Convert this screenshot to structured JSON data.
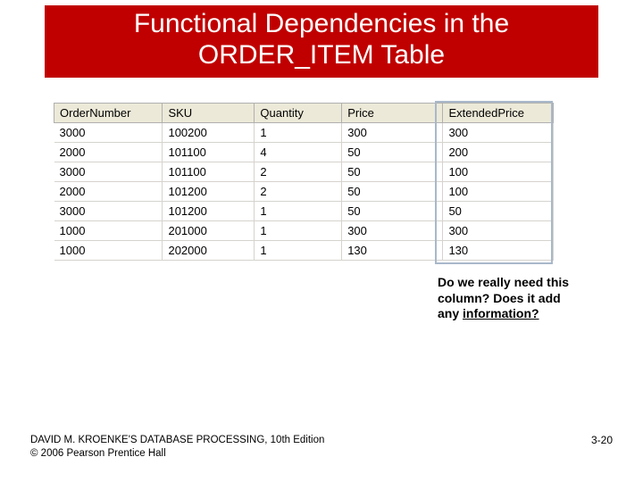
{
  "slide": {
    "title_line1": "Functional Dependencies in the",
    "title_line2": "ORDER_ITEM Table"
  },
  "table": {
    "headers": {
      "ordernum": "OrderNumber",
      "sku": "SKU",
      "qty": "Quantity",
      "price": "Price",
      "ext": "ExtendedPrice"
    },
    "rows": [
      {
        "ordernum": "3000",
        "sku": "100200",
        "qty": "1",
        "price": "300",
        "ext": "300"
      },
      {
        "ordernum": "2000",
        "sku": "101100",
        "qty": "4",
        "price": "50",
        "ext": "200"
      },
      {
        "ordernum": "3000",
        "sku": "101100",
        "qty": "2",
        "price": "50",
        "ext": "100"
      },
      {
        "ordernum": "2000",
        "sku": "101200",
        "qty": "2",
        "price": "50",
        "ext": "100"
      },
      {
        "ordernum": "3000",
        "sku": "101200",
        "qty": "1",
        "price": "50",
        "ext": "50"
      },
      {
        "ordernum": "1000",
        "sku": "201000",
        "qty": "1",
        "price": "300",
        "ext": "300"
      },
      {
        "ordernum": "1000",
        "sku": "202000",
        "qty": "1",
        "price": "130",
        "ext": "130"
      }
    ]
  },
  "callout": {
    "line1": "Do we really need this",
    "line2": "column? Does it add",
    "line3_prefix": "any ",
    "line3_under": "information?"
  },
  "footer": {
    "line1": "DAVID M. KROENKE'S DATABASE PROCESSING, 10th Edition",
    "line2": "© 2006 Pearson Prentice Hall",
    "pagenum": "3-20"
  }
}
